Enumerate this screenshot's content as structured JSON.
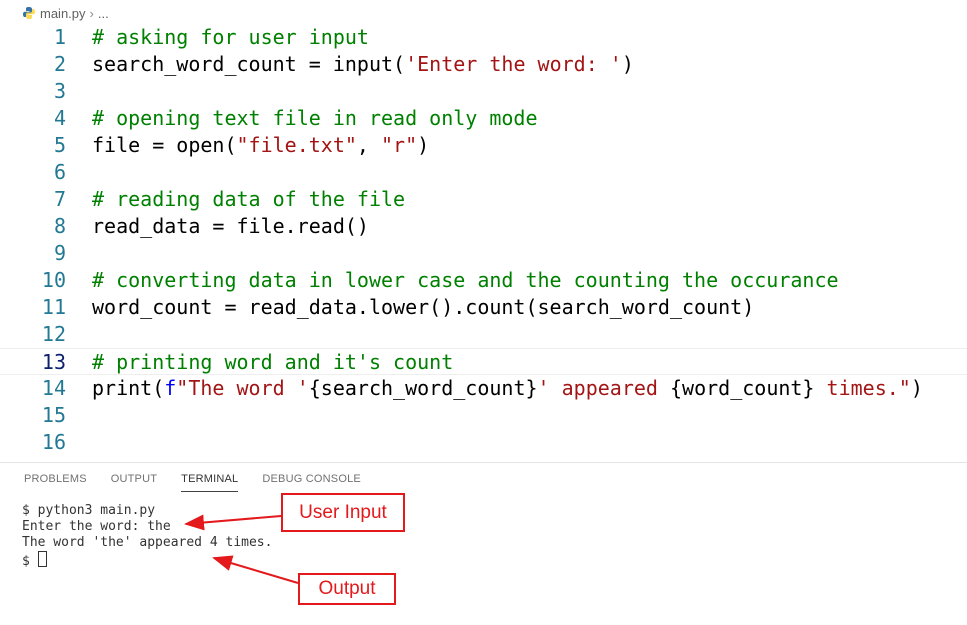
{
  "breadcrumb": {
    "file": "main.py",
    "separator": "›",
    "rest": "..."
  },
  "editor": {
    "current_line": 13,
    "lines": [
      {
        "n": "1",
        "tokens": [
          {
            "t": "# asking for user input",
            "c": "c"
          }
        ]
      },
      {
        "n": "2",
        "tokens": [
          {
            "t": "search_word_count = input(",
            "c": "fn"
          },
          {
            "t": "'Enter the word: '",
            "c": "s"
          },
          {
            "t": ")",
            "c": "fn"
          }
        ]
      },
      {
        "n": "3",
        "tokens": []
      },
      {
        "n": "4",
        "tokens": [
          {
            "t": "# opening text file in read only mode",
            "c": "c"
          }
        ]
      },
      {
        "n": "5",
        "tokens": [
          {
            "t": "file = open(",
            "c": "fn"
          },
          {
            "t": "\"file.txt\"",
            "c": "s"
          },
          {
            "t": ", ",
            "c": "fn"
          },
          {
            "t": "\"r\"",
            "c": "s"
          },
          {
            "t": ")",
            "c": "fn"
          }
        ]
      },
      {
        "n": "6",
        "tokens": []
      },
      {
        "n": "7",
        "tokens": [
          {
            "t": "# reading data of the file",
            "c": "c"
          }
        ]
      },
      {
        "n": "8",
        "tokens": [
          {
            "t": "read_data = file.read()",
            "c": "fn"
          }
        ]
      },
      {
        "n": "9",
        "tokens": []
      },
      {
        "n": "10",
        "tokens": [
          {
            "t": "# converting data in lower case and the counting the occurance",
            "c": "c"
          }
        ]
      },
      {
        "n": "11",
        "tokens": [
          {
            "t": "word_count = read_data.lower().count(search_word_count)",
            "c": "fn"
          }
        ]
      },
      {
        "n": "12",
        "tokens": []
      },
      {
        "n": "13",
        "tokens": [
          {
            "t": "# printing word and it's count",
            "c": "c"
          }
        ]
      },
      {
        "n": "14",
        "tokens": [
          {
            "t": "print(",
            "c": "fn"
          },
          {
            "t": "f",
            "c": "kw"
          },
          {
            "t": "\"The word '",
            "c": "s"
          },
          {
            "t": "{search_word_count}",
            "c": "fn"
          },
          {
            "t": "' appeared ",
            "c": "s"
          },
          {
            "t": "{word_count}",
            "c": "fn"
          },
          {
            "t": " times.\"",
            "c": "s"
          },
          {
            "t": ")",
            "c": "fn"
          }
        ]
      },
      {
        "n": "15",
        "tokens": []
      },
      {
        "n": "16",
        "tokens": []
      }
    ]
  },
  "panel": {
    "tabs": [
      "PROBLEMS",
      "OUTPUT",
      "TERMINAL",
      "DEBUG CONSOLE"
    ],
    "active_tab": "TERMINAL",
    "terminal": {
      "line1": "$ python3 main.py",
      "line2": "Enter the word: the",
      "line3": "The word 'the' appeared 4 times.",
      "prompt": "$ "
    }
  },
  "annotations": {
    "user_input": "User Input",
    "output": "Output",
    "color": "#e3191c"
  }
}
